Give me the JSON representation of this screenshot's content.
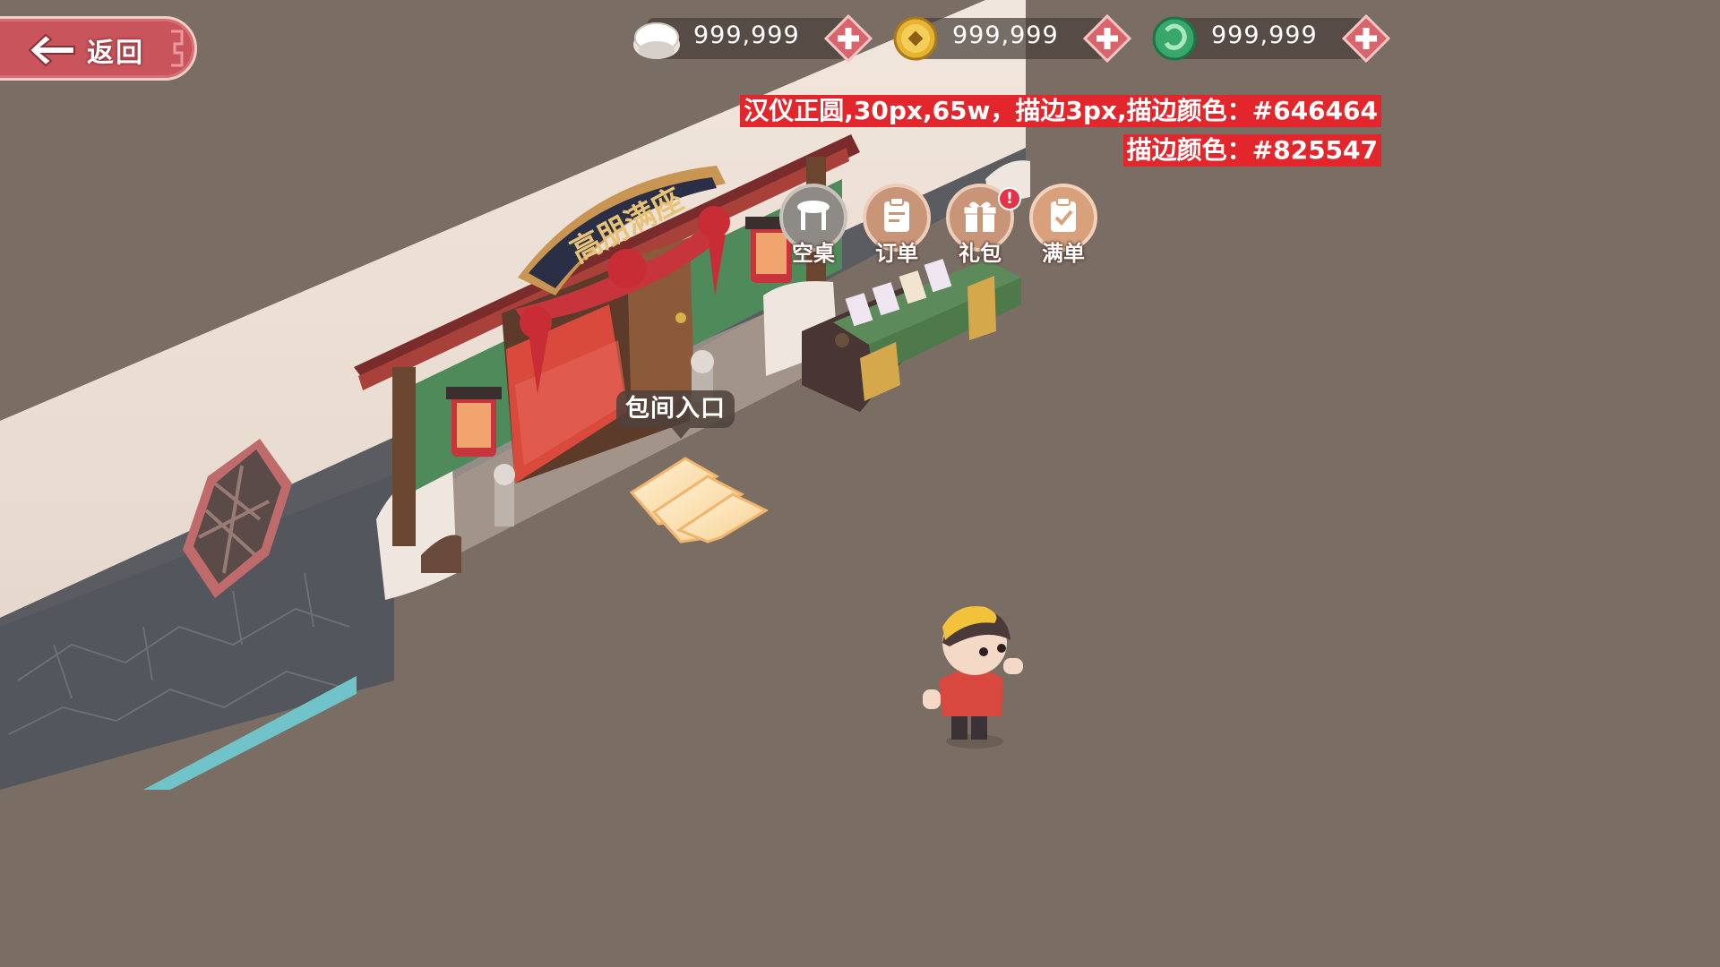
{
  "back_button": {
    "label": "返回"
  },
  "currencies": [
    {
      "name": "rice-bowl-icon",
      "value": "999,999"
    },
    {
      "name": "gold-coin-icon",
      "value": "999,999"
    },
    {
      "name": "jade-dragon-icon",
      "value": "999,999"
    }
  ],
  "annotation": {
    "line1": "汉仪正圆,30px,65w，描边3px,描边颜色：#646464",
    "line2": "描边颜色：#825547"
  },
  "actions": [
    {
      "label": "空桌",
      "icon": "table-icon"
    },
    {
      "label": "订单",
      "icon": "order-icon"
    },
    {
      "label": "礼包",
      "icon": "gift-icon",
      "badge": "!"
    },
    {
      "label": "满单",
      "icon": "full-order-icon"
    }
  ],
  "signboard": {
    "text": "高朋满座"
  },
  "entrance_tip": {
    "label": "包间入口"
  },
  "colors": {
    "background": "#7a6d63",
    "back_button": "#c9545c",
    "plus_button": "#d9646c",
    "annotation_bg": "#e3262b"
  }
}
